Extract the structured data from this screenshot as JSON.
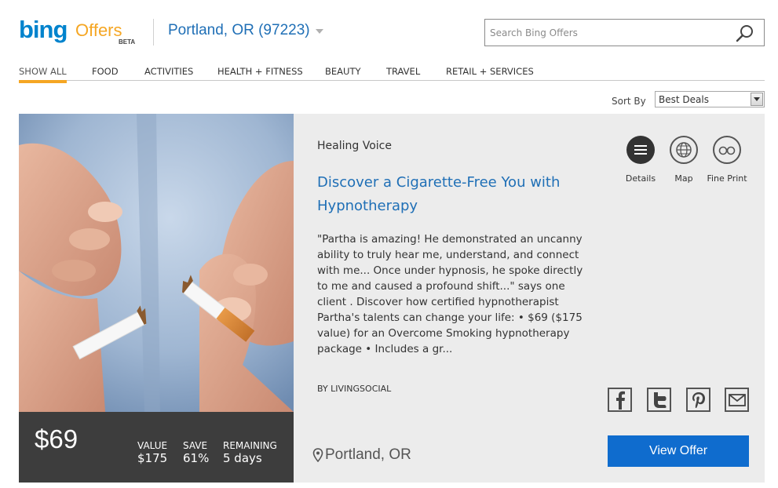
{
  "header": {
    "logo_bing": "bing",
    "logo_offers": "Offers",
    "logo_beta": "BETA",
    "location": "Portland, OR (97223)",
    "search_placeholder": "Search Bing Offers"
  },
  "nav": {
    "items": [
      {
        "label": "SHOW ALL",
        "active": true
      },
      {
        "label": "FOOD"
      },
      {
        "label": "ACTIVITIES"
      },
      {
        "label": "HEALTH + FITNESS"
      },
      {
        "label": "BEAUTY"
      },
      {
        "label": "TRAVEL"
      },
      {
        "label": "RETAIL + SERVICES"
      }
    ]
  },
  "sort": {
    "label": "Sort By",
    "selected": "Best Deals"
  },
  "offer": {
    "merchant": "Healing Voice",
    "title": "Discover a Cigarette-Free You with Hypnotherapy",
    "description": "\"Partha is amazing! He demonstrated an uncanny ability to truly hear me, understand, and connect with me... Once under hypnosis, he spoke directly to me and caused a profound shift...\" says one client . Discover how certified hypnotherapist Partha's talents can change your life: • $69 ($175 value) for an Overcome Smoking hypnotherapy package • Includes a gr...",
    "byline": "BY LIVINGSOCIAL",
    "location": "Portland, OR",
    "price": "$69",
    "value_label": "VALUE",
    "value": "$175",
    "save_label": "SAVE",
    "save": "61%",
    "remaining_label": "REMAINING",
    "remaining": "5 days",
    "actions": {
      "details": "Details",
      "map": "Map",
      "fine_print": "Fine Print"
    },
    "view_button": "View Offer"
  },
  "colors": {
    "accent_blue": "#1f6fb6",
    "button_blue": "#0f6cce",
    "nav_active_underline": "#f5a623",
    "price_bar_bg": "#3d3d3d"
  }
}
